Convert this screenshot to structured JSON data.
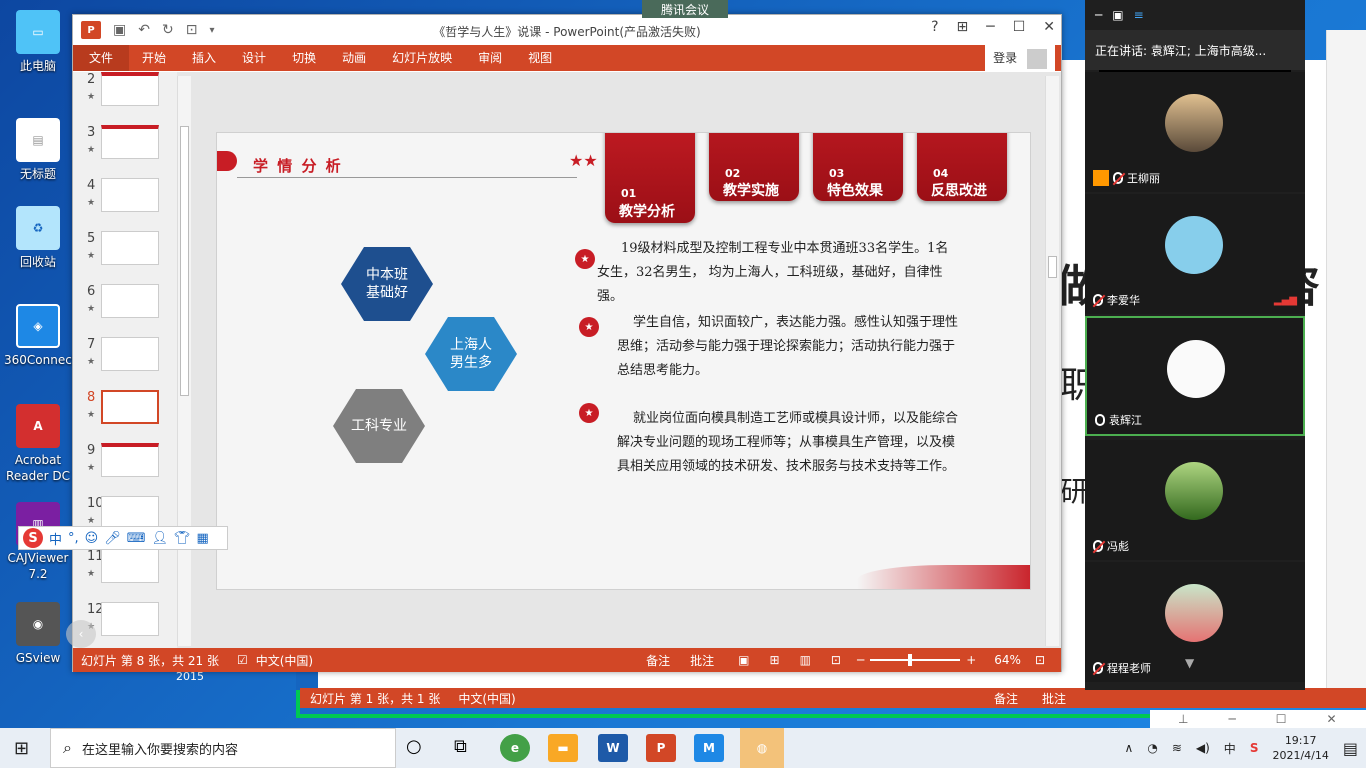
{
  "desktop": {
    "icons": [
      {
        "label": "此电脑"
      },
      {
        "label": "无标题"
      },
      {
        "label": "回收站"
      },
      {
        "label": "360Connect"
      },
      {
        "label": "Acrobat Reader DC"
      },
      {
        "label": "CAJViewer 7.2"
      },
      {
        "label": "GSview"
      }
    ]
  },
  "meeting_badge": "腾讯会议",
  "ppt": {
    "title": "《哲学与人生》说课 - PowerPoint(产品激活失败)",
    "ribbon_tabs": [
      "文件",
      "开始",
      "插入",
      "设计",
      "切换",
      "动画",
      "幻灯片放映",
      "审阅",
      "视图"
    ],
    "login": "登录",
    "thumbnails": [
      "2",
      "3",
      "4",
      "5",
      "6",
      "7",
      "8",
      "9",
      "10",
      "11",
      "12"
    ],
    "selected_thumb": "8",
    "status": {
      "slide_info": "幻灯片 第 8 张，共 21 张",
      "language": "中文(中国)",
      "notes": "备注",
      "comments": "批注",
      "zoom": "64%"
    },
    "slide": {
      "section_title": "学 情 分 析",
      "tabs": [
        {
          "num": "01",
          "label": "教学分析"
        },
        {
          "num": "02",
          "label": "教学实施"
        },
        {
          "num": "03",
          "label": "特色效果"
        },
        {
          "num": "04",
          "label": "反思改进"
        }
      ],
      "hexes": [
        {
          "line1": "中本班",
          "line2": "基础好"
        },
        {
          "line1": "上海人",
          "line2": "男生多"
        },
        {
          "line1": "工科专业",
          "line2": ""
        }
      ],
      "paragraphs": [
        "19级材料成型及控制工程专业中本贯通班33名学生。1名女生，32名男生， 均为上海人，工科班级，基础好，自律性强。",
        "学生自信，知识面较广，表达能力强。感性认知强于理性思维；活动参与能力强于理论探索能力；活动执行能力强于总结思考能力。",
        "就业岗位面向模具制造工艺师或模具设计师，以及能综合解决专业问题的现场工程师等；从事模具生产管理，以及模具相关应用领域的技术研发、技术服务与技术支持等工作。"
      ]
    }
  },
  "bgppt": {
    "status": {
      "slide_info": "幻灯片 第 1 张，共 1 张",
      "language": "中文(中国)",
      "notes": "备注",
      "comments": "批注"
    },
    "slide_fragments": [
      "做",
      "咨",
      "职",
      "研"
    ],
    "small_text": "2015"
  },
  "meeting": {
    "speaking": "正在讲话: 袁辉江; 上海市高级...",
    "participants": [
      {
        "name": "王柳丽"
      },
      {
        "name": "李爱华"
      },
      {
        "name": "袁辉江"
      },
      {
        "name": "冯彪"
      },
      {
        "name": "程程老师"
      }
    ]
  },
  "taskbar": {
    "search_placeholder": "在这里输入你要搜索的内容",
    "time": "19:17",
    "date": "2021/4/14",
    "ime": "中"
  }
}
